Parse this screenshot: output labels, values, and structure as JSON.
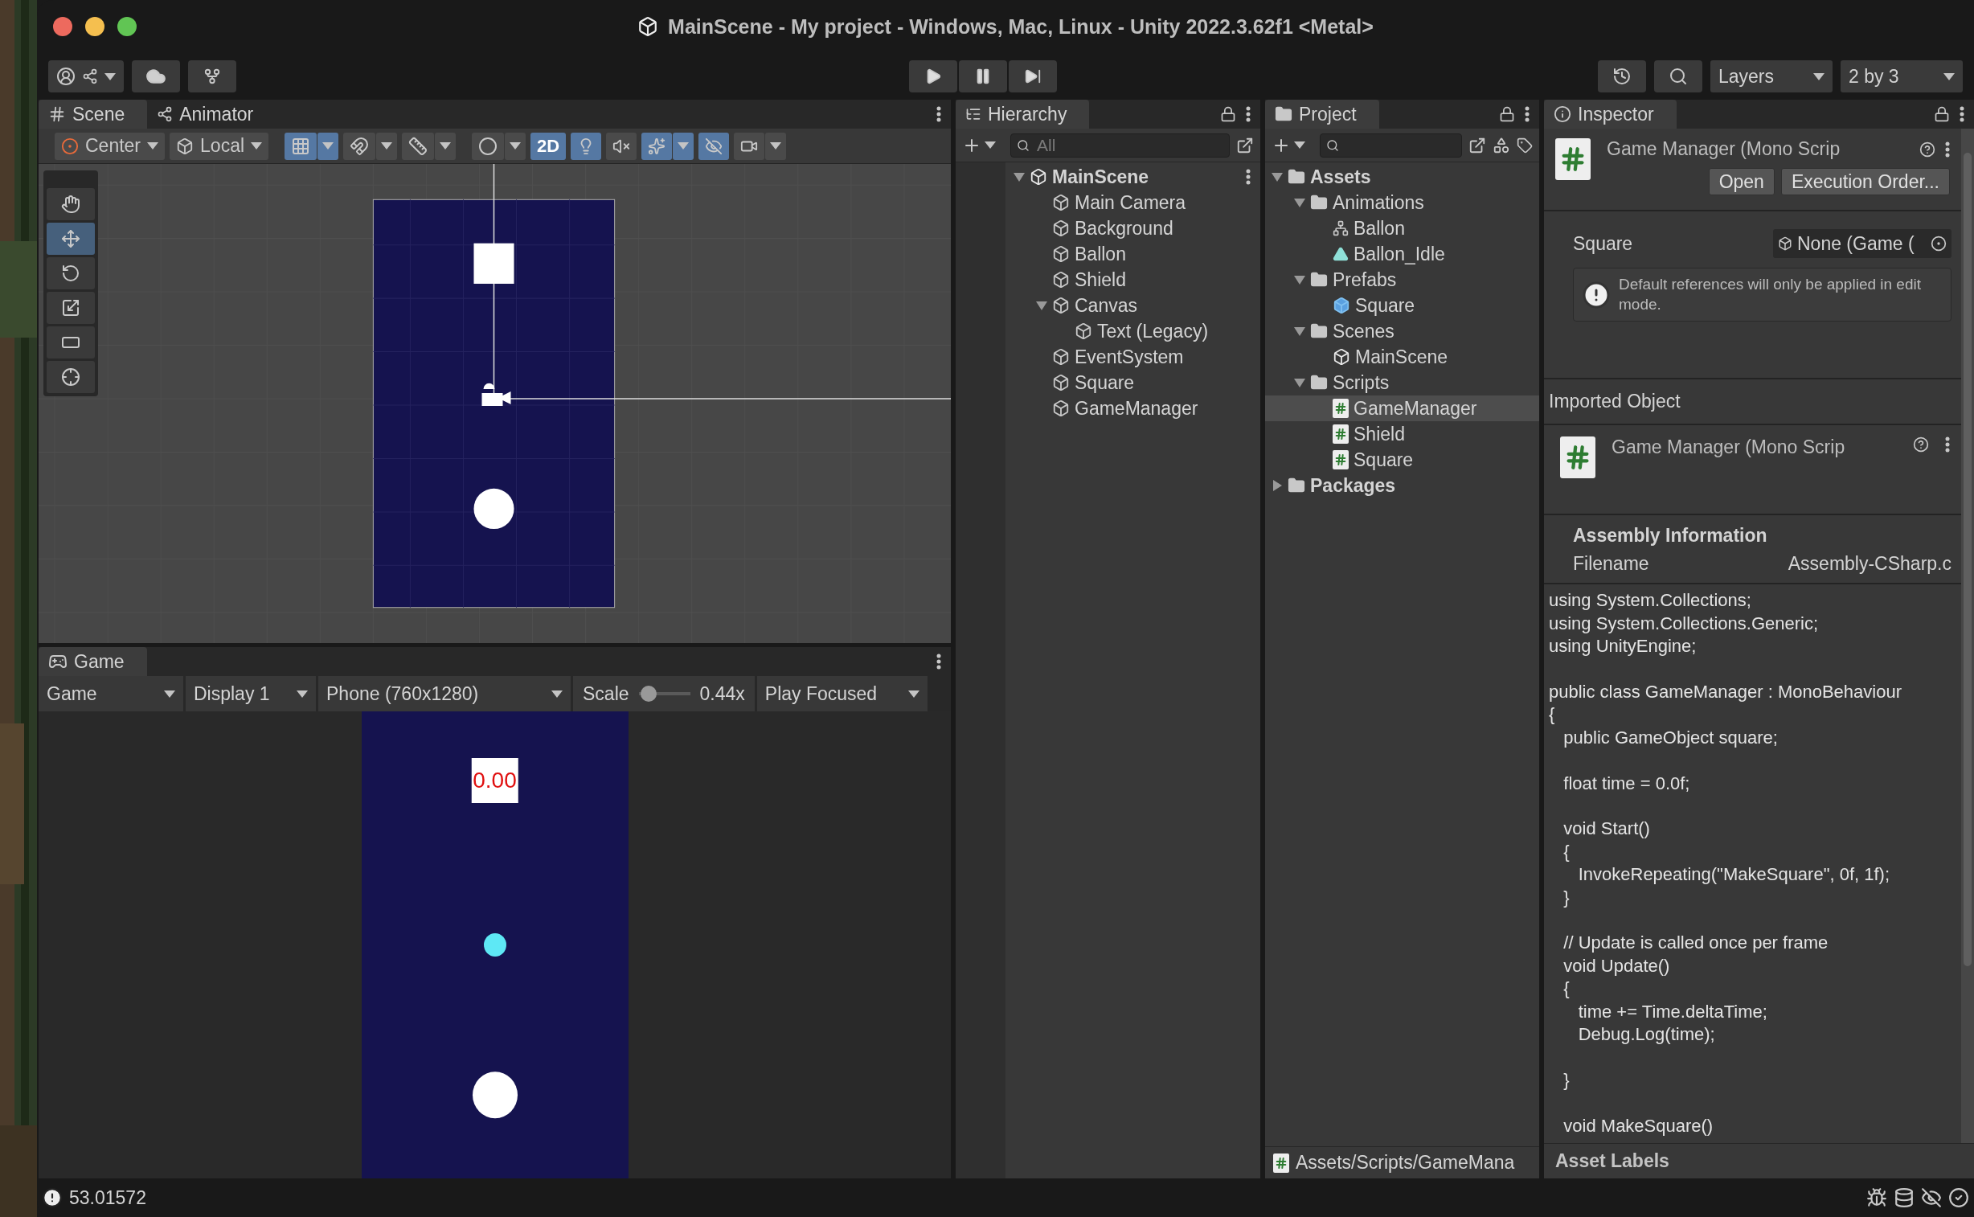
{
  "window": {
    "title": "MainScene - My project - Windows, Mac, Linux - Unity 2022.3.62f1 <Metal>"
  },
  "toolbar": {
    "layers": "Layers",
    "layout": "2 by 3"
  },
  "scene": {
    "tabs": [
      {
        "label": "Scene",
        "selected": true
      },
      {
        "label": "Animator",
        "selected": false
      }
    ],
    "pivot": "Center",
    "space": "Local",
    "toggles": [
      {
        "kind": "grid",
        "on": true
      },
      {
        "kind": "snap",
        "on": false
      },
      {
        "kind": "ruler",
        "on": false
      },
      {
        "kind": "shading",
        "on": false
      },
      {
        "kind": "mode",
        "label": "2D",
        "on": true
      },
      {
        "kind": "light",
        "on": true
      },
      {
        "kind": "audio",
        "on": false
      },
      {
        "kind": "fx",
        "on": true
      },
      {
        "kind": "visibility",
        "on": true
      },
      {
        "kind": "camera",
        "on": false
      }
    ],
    "tools": [
      {
        "kind": "hand",
        "selected": false
      },
      {
        "kind": "move",
        "selected": true
      },
      {
        "kind": "rotate",
        "selected": false
      },
      {
        "kind": "scale",
        "selected": false
      },
      {
        "kind": "rect",
        "selected": false
      },
      {
        "kind": "transform",
        "selected": false
      }
    ]
  },
  "game": {
    "tabs": [
      {
        "label": "Game",
        "selected": true
      }
    ],
    "view": "Game",
    "display": "Display 1",
    "resolution": "Phone (760x1280)",
    "scale_label": "Scale",
    "scale": {
      "level": 0.05
    },
    "scale_value": "0.44x",
    "play_mode": "Play Focused",
    "timer": "0.00"
  },
  "hierarchy": {
    "tab": "Hierarchy",
    "search": {
      "placeholder": "All"
    },
    "items": [
      {
        "name": "MainScene",
        "kind": "scene",
        "expanded": true,
        "selected": false,
        "children": [
          {
            "name": "Main Camera",
            "kind": "object",
            "selected": false
          },
          {
            "name": "Background",
            "kind": "object",
            "selected": false
          },
          {
            "name": "Ballon",
            "kind": "object",
            "selected": false
          },
          {
            "name": "Shield",
            "kind": "object",
            "selected": false
          },
          {
            "name": "Canvas",
            "kind": "object",
            "expanded": true,
            "selected": false,
            "children": [
              {
                "name": "Text (Legacy)",
                "kind": "object",
                "selected": false
              }
            ]
          },
          {
            "name": "EventSystem",
            "kind": "object",
            "selected": false
          },
          {
            "name": "Square",
            "kind": "object",
            "selected": false
          },
          {
            "name": "GameManager",
            "kind": "object",
            "selected": false
          }
        ]
      }
    ]
  },
  "project": {
    "tab": "Project",
    "items": [
      {
        "name": "Assets",
        "kind": "folder",
        "expanded": true,
        "selected": false,
        "children": [
          {
            "name": "Animations",
            "kind": "folder",
            "expanded": true,
            "selected": false,
            "children": [
              {
                "name": "Ballon",
                "kind": "controller",
                "selected": false
              },
              {
                "name": "Ballon_Idle",
                "kind": "clip",
                "selected": false
              }
            ]
          },
          {
            "name": "Prefabs",
            "kind": "folder",
            "expanded": true,
            "selected": false,
            "children": [
              {
                "name": "Square",
                "kind": "prefab",
                "selected": false
              }
            ]
          },
          {
            "name": "Scenes",
            "kind": "folder",
            "expanded": true,
            "selected": false,
            "children": [
              {
                "name": "MainScene",
                "kind": "scene",
                "selected": false
              }
            ]
          },
          {
            "name": "Scripts",
            "kind": "folder",
            "expanded": true,
            "selected": false,
            "children": [
              {
                "name": "GameManager",
                "kind": "script",
                "selected": true
              },
              {
                "name": "Shield",
                "kind": "script",
                "selected": false
              },
              {
                "name": "Square",
                "kind": "script",
                "selected": false
              }
            ]
          }
        ]
      },
      {
        "name": "Packages",
        "kind": "folder",
        "expanded": false,
        "selected": false
      }
    ],
    "path": "Assets/Scripts/GameMana"
  },
  "inspector": {
    "tab": "Inspector",
    "title": "Game Manager (Mono Scrip",
    "buttons": [
      "Open",
      "Execution Order..."
    ],
    "field": {
      "label": "Square",
      "value": "None (Game ("
    },
    "help": "Default references will only be applied in edit mode.",
    "imported_label": "Imported Object",
    "imported_title": "Game Manager (Mono Scrip",
    "assembly_heading": "Assembly Information",
    "filename_label": "Filename",
    "filename": "Assembly-CSharp.c",
    "code": "using System.Collections;\nusing System.Collections.Generic;\nusing UnityEngine;\n\npublic class GameManager : MonoBehaviour\n{\n   public GameObject square;\n\n   float time = 0.0f;\n\n   void Start()\n   {\n      InvokeRepeating(\"MakeSquare\", 0f, 1f);\n   }\n\n   // Update is called once per frame\n   void Update()\n   {\n      time += Time.deltaTime;\n      Debug.Log(time);\n\n   }\n\n   void MakeSquare()",
    "labels": "Asset Labels"
  },
  "status": {
    "message": "53.01572"
  }
}
